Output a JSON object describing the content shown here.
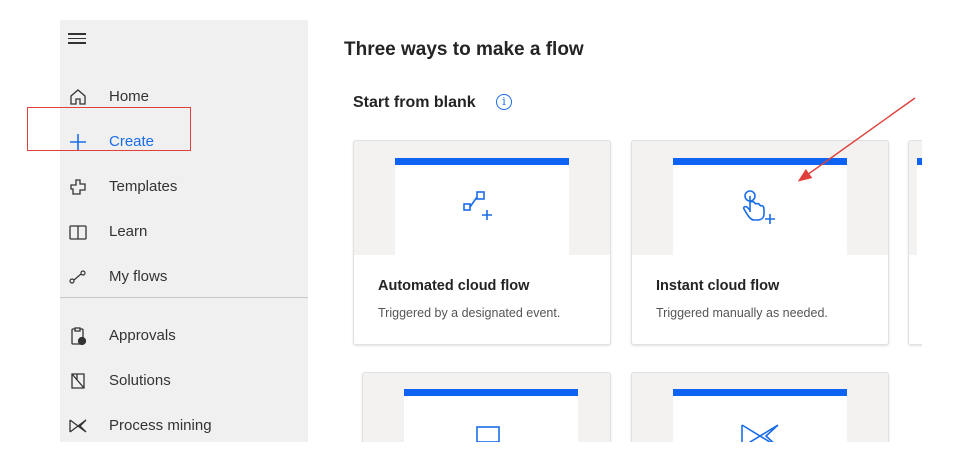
{
  "sidebar": {
    "items": [
      {
        "label": "Home",
        "icon": "home-icon"
      },
      {
        "label": "Create",
        "icon": "plus-icon"
      },
      {
        "label": "Templates",
        "icon": "templates-icon"
      },
      {
        "label": "Learn",
        "icon": "book-icon"
      },
      {
        "label": "My flows",
        "icon": "flows-icon"
      },
      {
        "label": "Approvals",
        "icon": "approvals-icon"
      },
      {
        "label": "Solutions",
        "icon": "solutions-icon"
      },
      {
        "label": "Process mining",
        "icon": "process-mining-icon"
      }
    ]
  },
  "main": {
    "title": "Three ways to make a flow",
    "section": "Start from blank",
    "cards": [
      {
        "name": "Automated cloud flow",
        "desc": "Triggered by a designated event.",
        "icon": "automated-flow-icon"
      },
      {
        "name": "Instant cloud flow",
        "desc": "Triggered manually as needed.",
        "icon": "touch-hand-icon"
      },
      {
        "name": "",
        "desc": "",
        "icon": "desktop-flow-icon"
      },
      {
        "name": "",
        "desc": "",
        "icon": "process-mining-icon"
      }
    ]
  },
  "colors": {
    "accent": "#1a6de8",
    "card_bar": "#0f63f2",
    "annotation": "#e0403c",
    "sidebar_bg": "#f0f0f0"
  }
}
